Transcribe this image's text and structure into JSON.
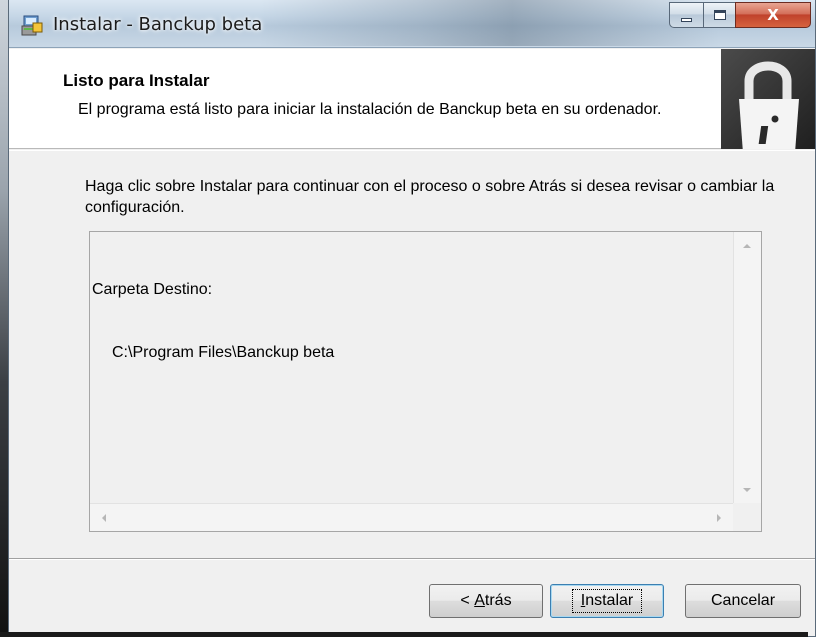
{
  "window": {
    "title": "Instalar - Banckup beta",
    "caption_buttons": {
      "minimize": "–",
      "maximize": "□",
      "close": "X"
    }
  },
  "header": {
    "title": "Listo para Instalar",
    "subtitle": "El programa está listo para iniciar la instalación de Banckup beta en su ordenador.",
    "image_icon": "padlock-info-icon"
  },
  "body": {
    "instructions": "Haga clic sobre Instalar para continuar con el proceso o sobre Atrás si desea revisar o cambiar la configuración.",
    "memo": {
      "label": "Carpeta Destino:",
      "value": "C:\\Program Files\\Banckup beta"
    }
  },
  "buttons": {
    "back_prefix": "< ",
    "back_mnemonic": "A",
    "back_rest": "trás",
    "install_mnemonic": "I",
    "install_rest": "nstalar",
    "cancel": "Cancelar"
  },
  "icons": {
    "app": "installer-icon",
    "minimize": "minimize-icon",
    "maximize": "maximize-icon",
    "close": "close-icon"
  },
  "colors": {
    "close_button": "#c0422b",
    "title_bar": "#c5d6e6",
    "dialog_background": "#f0f0f0",
    "default_button_border": "#3c7fb1"
  }
}
